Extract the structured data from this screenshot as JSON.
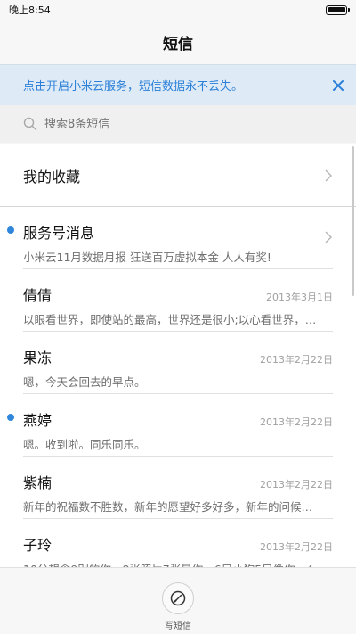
{
  "status": {
    "time": "晚上8:54",
    "battery_level": 1.0
  },
  "header": {
    "title": "短信"
  },
  "banner": {
    "text": "点击开启小米云服务，短信数据永不丢失。",
    "accent": "#2b7fd8",
    "close_icon": "close-icon"
  },
  "search": {
    "placeholder": "搜索8条短信",
    "icon": "search-icon"
  },
  "favorites": {
    "label": "我的收藏"
  },
  "conversations": [
    {
      "name": "服务号消息",
      "date": "",
      "preview": "小米云11月数据月报 狂送百万虚拟本金 人人有奖!",
      "unread": true
    },
    {
      "name": "倩倩",
      "date": "2013年3月1日",
      "preview": "以眼看世界，即使站的最高，世界还是很小;以心看世界，…",
      "unread": false
    },
    {
      "name": "果冻",
      "date": "2013年2月22日",
      "preview": "嗯，今天会回去的早点。",
      "unread": false
    },
    {
      "name": "燕婷",
      "date": "2013年2月22日",
      "preview": "嗯。收到啦。同乐同乐。",
      "unread": true
    },
    {
      "name": "紫楠",
      "date": "2013年2月22日",
      "preview": "新年的祝福数不胜数，新年的愿望好多好多，新年的问候…",
      "unread": false
    },
    {
      "name": "子玲",
      "date": "2013年2月22日",
      "preview": "10分想念9别的你，8张照片7张是你，6只小狗5只像你，4…",
      "unread": false
    }
  ],
  "bottom": {
    "compose_label": "写短信",
    "compose_icon": "compose-icon"
  }
}
